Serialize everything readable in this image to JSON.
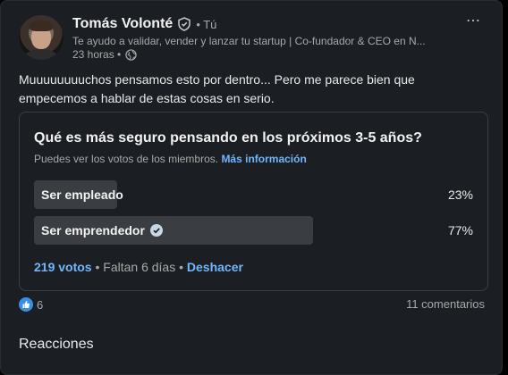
{
  "post": {
    "author": {
      "name": "Tomás Volonté",
      "degree": "• Tú",
      "headline": "Te ayudo a validar, vender y lanzar tu startup | Co-fundador & CEO en N...",
      "time": "23 horas •"
    },
    "text_line1": "Muuuuuuuuchos pensamos esto por dentro... Pero me parece bien que",
    "text_line2": "empecemos a hablar de estas cosas en serio.",
    "more_icon": "⋯"
  },
  "poll": {
    "question": "Qué es más seguro pensando en los próximos 3-5 años?",
    "info": "Puedes ver los votos de los miembros.",
    "info_link": "Más información",
    "options": [
      {
        "label": "Ser empleado",
        "percent": "23%",
        "fill": 0.19,
        "selected": false
      },
      {
        "label": "Ser emprendedor",
        "percent": "77%",
        "fill": 0.635,
        "selected": true
      }
    ],
    "votes": "219 votos",
    "remaining": " • Faltan 6 días • ",
    "undo": "Deshacer"
  },
  "social": {
    "reaction_count": "6",
    "comments": "11 comentarios"
  },
  "reactions_title": "Reacciones",
  "colors": {
    "accent": "#71b7fb",
    "card": "#1b1f23",
    "bar": "#3a3e42"
  }
}
